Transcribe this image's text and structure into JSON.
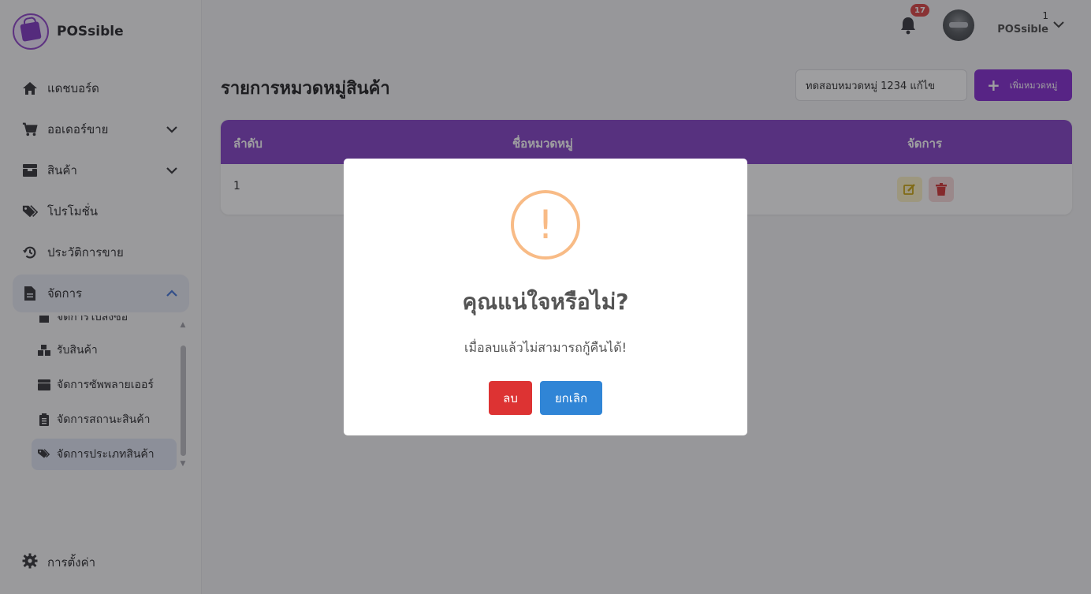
{
  "brand": {
    "name": "POSsible"
  },
  "sidebar": {
    "items": [
      {
        "label": "แดชบอร์ด",
        "icon": "home-icon"
      },
      {
        "label": "ออเดอร์ขาย",
        "icon": "cart-icon"
      },
      {
        "label": "สินค้า",
        "icon": "box-icon"
      },
      {
        "label": "โปรโมชั่น",
        "icon": "tags-icon"
      },
      {
        "label": "ประวัติการขาย",
        "icon": "history-icon"
      },
      {
        "label": "จัดการ",
        "icon": "document-icon"
      }
    ],
    "sub_items": [
      {
        "label": "จัดการใบสั่งซื้อ",
        "icon": "file-icon"
      },
      {
        "label": "รับสินค้า",
        "icon": "boxes-icon"
      },
      {
        "label": "จัดการซัพพลายเออร์",
        "icon": "box-icon"
      },
      {
        "label": "จัดการสถานะสินค้า",
        "icon": "clipboard-icon"
      },
      {
        "label": "จัดการประเภทสินค้า",
        "icon": "tags-icon"
      }
    ],
    "settings_label": "การตั้งค่า"
  },
  "header": {
    "notification_count": "17",
    "user_id": "1",
    "user_name": "POSsible"
  },
  "main": {
    "title": "รายการหมวดหมู่สินค้า",
    "search_value": "ทดสอบหมวดหมู่ 1234 แก้ไข",
    "add_button_label": "เพิ่มหมวดหมู่",
    "table": {
      "headers": [
        "ลำดับ",
        "ชื่อหมวดหมู่",
        "จัดการ"
      ],
      "rows": [
        {
          "index": "1"
        }
      ]
    }
  },
  "modal": {
    "icon_text": "!",
    "title": "คุณแน่ใจหรือไม่?",
    "text": "เมื่อลบแล้วไม่สามารถกู้คืนได้!",
    "confirm_label": "ลบ",
    "cancel_label": "ยกเลิก"
  },
  "colors": {
    "accent": "#7e22ce",
    "table_header": "#7e3ac3",
    "confirm": "#dd3333",
    "cancel": "#3085d6",
    "warning": "#f8bb86"
  }
}
